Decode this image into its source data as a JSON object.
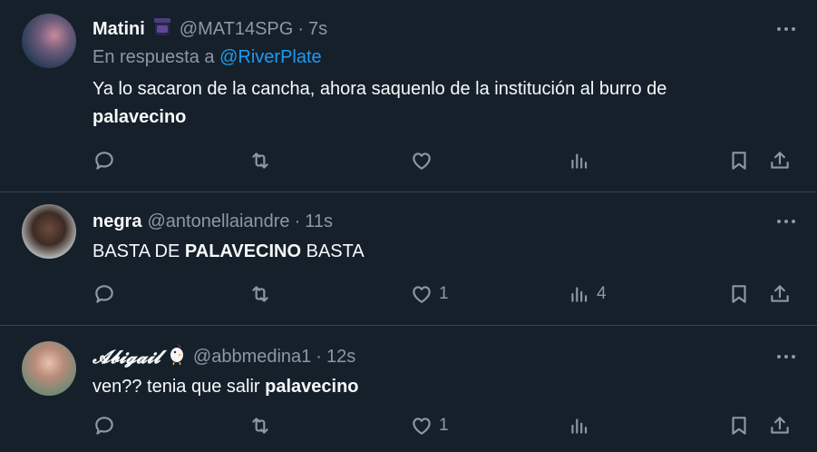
{
  "tweets": [
    {
      "name": "Matini",
      "badge": "jar-icon",
      "handle": "@MAT14SPG",
      "time": "7s",
      "reply_prefix": "En respuesta a",
      "reply_mention": "@RiverPlate",
      "text_line1": "Ya lo sacaron de la cancha, ahora saquenlo de la institución al burro de",
      "text_bold": "palavecino",
      "likes": "",
      "views": ""
    },
    {
      "name": "negra",
      "handle": "@antonellaiandre",
      "time": "11s",
      "text_a": "BASTA DE ",
      "text_bold": "PALAVECINO",
      "text_b": " BASTA",
      "likes": "1",
      "views": "4"
    },
    {
      "name": "𝓐𝓫𝓲𝓰𝓪𝓲𝓵",
      "badge": "chicken-icon",
      "handle": "@abbmedina1",
      "time": "12s",
      "text_a": "ven?? tenia que salir ",
      "text_bold": "palavecino",
      "likes": "1",
      "views": ""
    }
  ],
  "colors": {
    "background": "#15202b",
    "text": "#f7f9f9",
    "secondary": "#8b98a5",
    "link": "#1d9bf0",
    "divider": "#38444d"
  }
}
